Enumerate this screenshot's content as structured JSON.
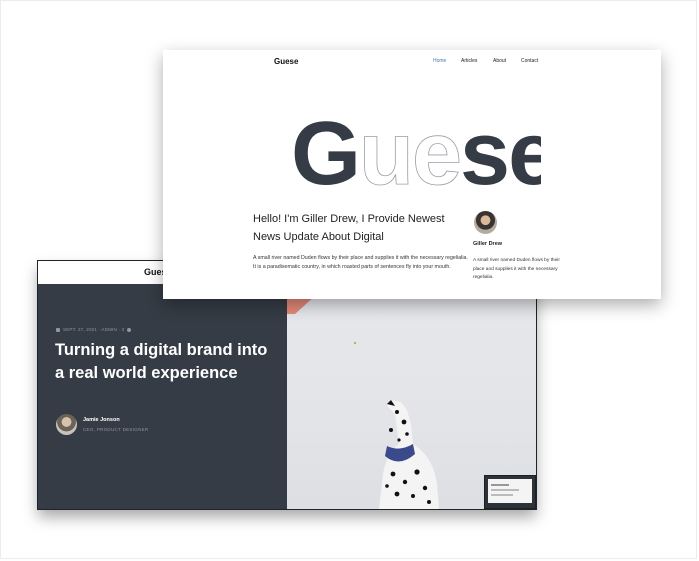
{
  "back_window": {
    "logo": "Guese",
    "meta": "SEPT. 27, 2021 · ADMIN · 3",
    "hero_title": "Turning a digital brand into a real world experience",
    "author": {
      "name": "Jamie Jonson",
      "role": "CEO, PRODUCT DESIGNER"
    }
  },
  "front_window": {
    "logo": "Guese",
    "nav": [
      "Home",
      "Articles",
      "About",
      "Contact"
    ],
    "active_nav": "Home",
    "hero_word": "Guese",
    "intro_title": "Hello! I'm Giller Drew, I Provide Newest News Update About Digital",
    "intro_text": "A small river named Duden flows by their place and supplies it with the necessary regelialia. It is a paradisematic country, in which roasted parts of sentences fly into your mouth.",
    "profile": {
      "name": "Giller Drew",
      "text": "A small river named Duden flows by their place and supplies it with the necessary regelialia."
    }
  },
  "colors": {
    "dark": "#353c45",
    "accent": "#4b7bb5",
    "meta_gray": "#8f97a3",
    "outline_gray": "#9aa0a8"
  }
}
